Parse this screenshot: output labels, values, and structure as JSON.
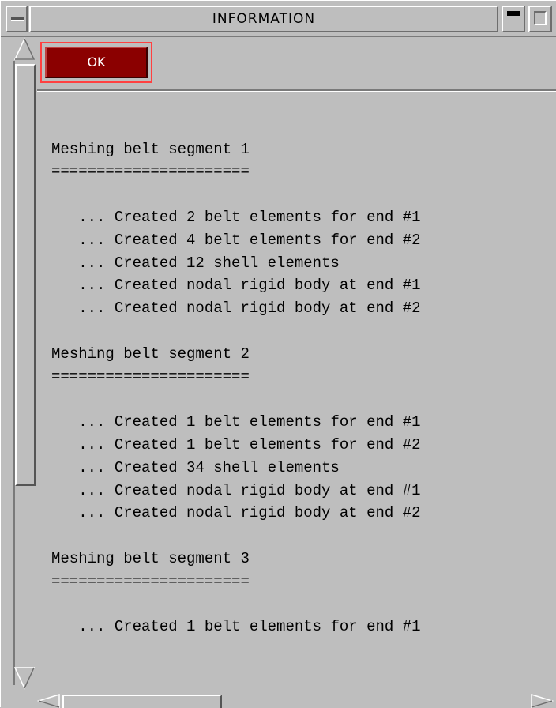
{
  "window": {
    "title": "INFORMATION"
  },
  "toolbar": {
    "ok_label": "OK"
  },
  "log_lines": [
    "",
    "",
    "Meshing belt segment 1",
    "======================",
    "",
    "   ... Created 2 belt elements for end #1",
    "   ... Created 4 belt elements for end #2",
    "   ... Created 12 shell elements",
    "   ... Created nodal rigid body at end #1",
    "   ... Created nodal rigid body at end #2",
    "",
    "Meshing belt segment 2",
    "======================",
    "",
    "   ... Created 1 belt elements for end #1",
    "   ... Created 1 belt elements for end #2",
    "   ... Created 34 shell elements",
    "   ... Created nodal rigid body at end #1",
    "   ... Created nodal rigid body at end #2",
    "",
    "Meshing belt segment 3",
    "======================",
    "",
    "   ... Created 1 belt elements for end #1"
  ],
  "icons": {
    "window_menu": "window-menu-icon",
    "minimize": "minimize-icon",
    "maximize": "maximize-icon",
    "scroll_up": "arrow-up-icon",
    "scroll_down": "arrow-down-icon",
    "scroll_left": "arrow-left-icon",
    "scroll_right": "arrow-right-icon"
  },
  "colors": {
    "background": "#bebebe",
    "ok_button": "#8b0000",
    "ok_focus_border": "#ff4040"
  }
}
